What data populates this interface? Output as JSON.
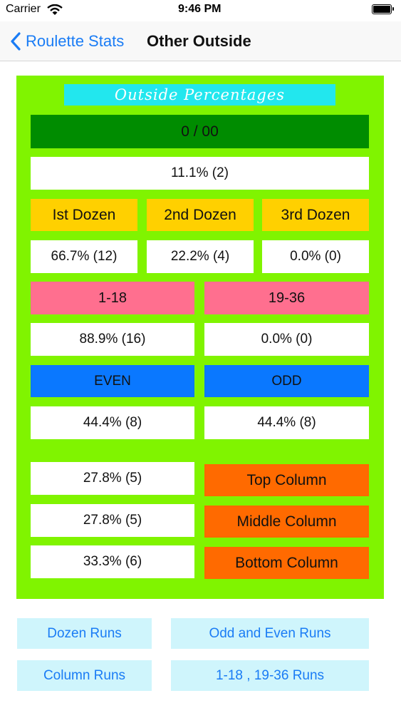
{
  "status": {
    "carrier": "Carrier",
    "time": "9:46 PM"
  },
  "nav": {
    "back_label": "Roulette Stats",
    "title": "Other Outside"
  },
  "panel": {
    "title": "Outside Percentages"
  },
  "zero": {
    "label": "0 / 00",
    "value": "11.1% (2)"
  },
  "dozens": [
    {
      "label": "Ist Dozen",
      "value": "66.7% (12)"
    },
    {
      "label": "2nd Dozen",
      "value": "22.2% (4)"
    },
    {
      "label": "3rd Dozen",
      "value": "0.0% (0)"
    }
  ],
  "halves": [
    {
      "label": "1-18",
      "value": "88.9% (16)"
    },
    {
      "label": "19-36",
      "value": "0.0% (0)"
    }
  ],
  "parity": [
    {
      "label": "EVEN",
      "value": "44.4% (8)"
    },
    {
      "label": "ODD",
      "value": "44.4% (8)"
    }
  ],
  "columns": [
    {
      "label": "Top Column",
      "value": "27.8% (5)"
    },
    {
      "label": "Middle Column",
      "value": "27.8% (5)"
    },
    {
      "label": "Bottom Column",
      "value": "33.3% (6)"
    }
  ],
  "buttons": {
    "dozen_runs": "Dozen Runs",
    "odd_even_runs": "Odd and Even Runs",
    "column_runs": "Column Runs",
    "halves_runs": "1-18 , 19-36 Runs"
  },
  "colors": {
    "panel": "#80f400",
    "title_bg": "#22e7ee",
    "zero": "#008c00",
    "dozen": "#ffd000",
    "halves": "#ff6f8f",
    "parity": "#0a78ff",
    "column": "#ff6a00",
    "button_bg": "#cff5fc",
    "link": "#1a7cf5"
  }
}
